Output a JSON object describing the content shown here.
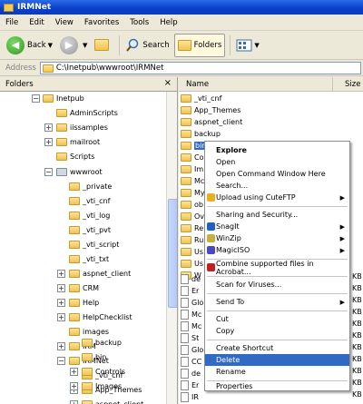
{
  "window": {
    "title": "IRMNet"
  },
  "menu": [
    "File",
    "Edit",
    "View",
    "Favorites",
    "Tools",
    "Help"
  ],
  "toolbar": {
    "back": "Back",
    "search": "Search",
    "folders": "Folders"
  },
  "address": {
    "label": "Address",
    "value": "C:\\Inetpub\\wwwroot\\IRMNet"
  },
  "folders_pane": {
    "title": "Folders",
    "close": "×"
  },
  "tree": [
    "Inetpub",
    "AdminScripts",
    "iissamples",
    "mailroot",
    "Scripts",
    "wwwroot",
    "_private",
    "_vti_cnf",
    "_vti_log",
    "_vti_pvt",
    "_vti_script",
    "_vti_txt",
    "aspnet_client",
    "CRM",
    "Help",
    "HelpChecklist",
    "images",
    "IRM",
    "IRMNet",
    "_vti_cnf",
    "App_Themes",
    "aspnet_client",
    "backup",
    "bin",
    "Controls",
    "Images"
  ],
  "list_header": {
    "name": "Name",
    "size": "Size"
  },
  "files": [
    "_vti_cnf",
    "App_Themes",
    "aspnet_client",
    "backup",
    "bin",
    "Co",
    "Im",
    "Mc",
    "My",
    "ob",
    "Ov",
    "Re",
    "Ru",
    "Us",
    "Us",
    "W",
    "de",
    "Er",
    "Glo",
    "Mc",
    "Mc",
    "St",
    "Glo",
    "CC",
    "de",
    "Er",
    "IR"
  ],
  "sizes": [
    "KB",
    "KB",
    "KB",
    "KB",
    "KB",
    "KB",
    "KB",
    "KB",
    "KB",
    "KB",
    "KB"
  ],
  "context_menu": [
    {
      "label": "Explore",
      "bold": true
    },
    {
      "label": "Open"
    },
    {
      "label": "Open Command Window Here"
    },
    {
      "label": "Search..."
    },
    {
      "label": "Upload using CuteFTP",
      "submenu": true,
      "icon": "cuteftp-icon"
    },
    {
      "sep": true
    },
    {
      "label": "Sharing and Security..."
    },
    {
      "label": "SnagIt",
      "submenu": true,
      "icon": "snagit-icon"
    },
    {
      "label": "WinZip",
      "submenu": true,
      "icon": "winzip-icon"
    },
    {
      "label": "MagicISO",
      "submenu": true,
      "icon": "magiciso-icon"
    },
    {
      "sep": true
    },
    {
      "label": "Combine supported files in Acrobat...",
      "icon": "acrobat-icon"
    },
    {
      "sep": true
    },
    {
      "label": "Scan for Viruses..."
    },
    {
      "sep": true
    },
    {
      "label": "Send To",
      "submenu": true
    },
    {
      "sep": true
    },
    {
      "label": "Cut"
    },
    {
      "label": "Copy"
    },
    {
      "sep": true
    },
    {
      "label": "Create Shortcut"
    },
    {
      "label": "Delete",
      "selected": true
    },
    {
      "label": "Rename"
    },
    {
      "sep": true
    },
    {
      "label": "Properties"
    }
  ],
  "colors": {
    "titlebar": "#0a3fc8",
    "selection": "#316ac5",
    "folder": "#f0c450"
  }
}
